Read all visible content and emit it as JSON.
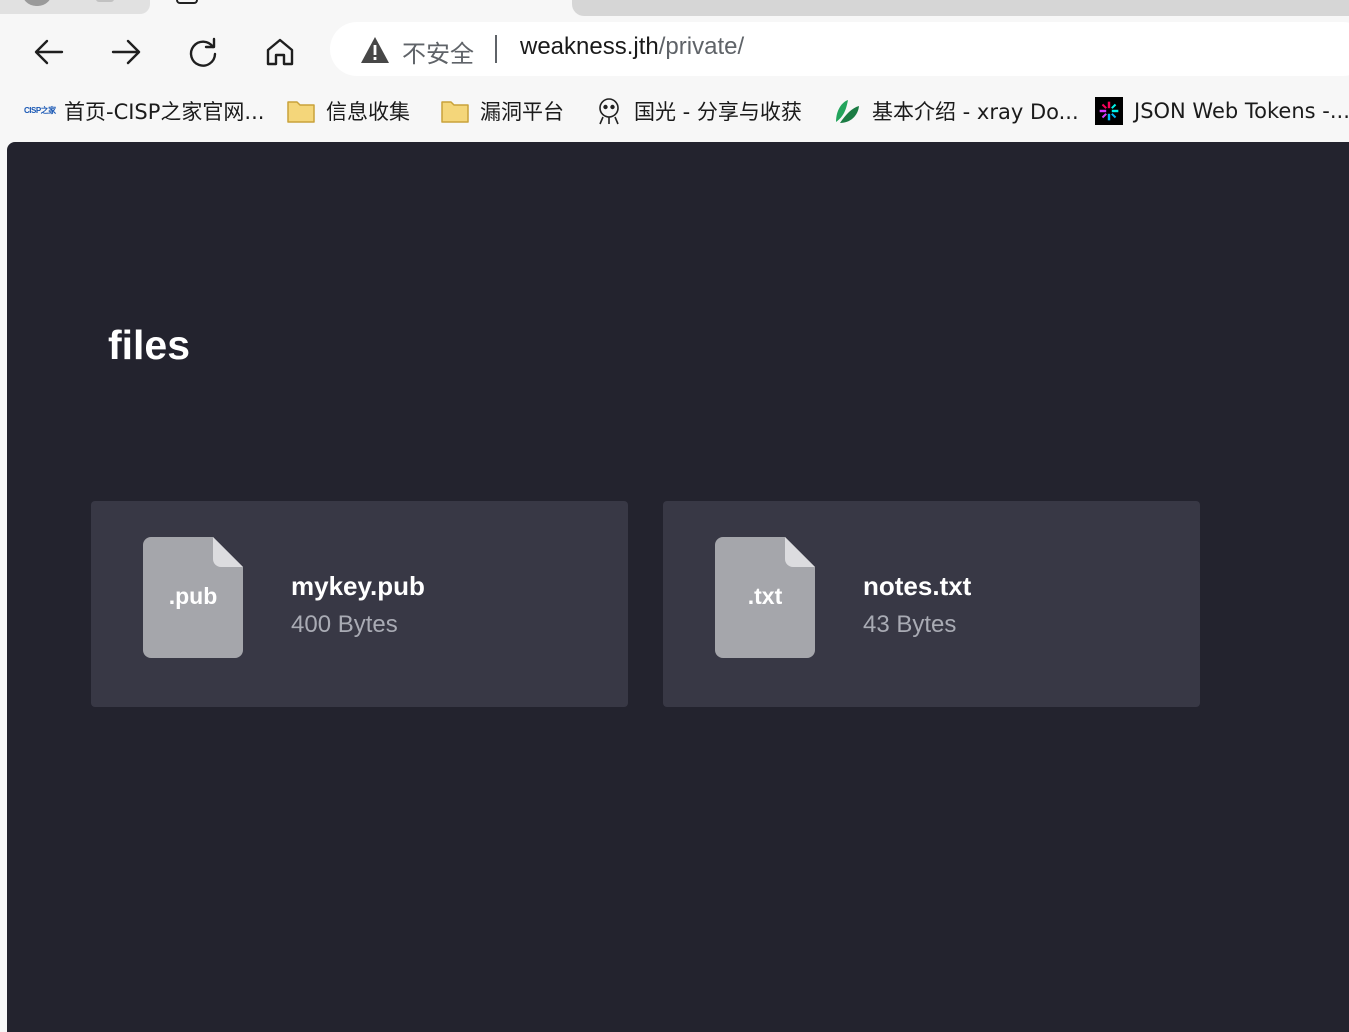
{
  "browser": {
    "address_bar": {
      "security_label": "不安全",
      "url_host": "weakness.jth",
      "url_path": "/private/"
    },
    "nav": {
      "back_icon": "arrow-left-icon",
      "forward_icon": "arrow-right-icon",
      "reload_icon": "reload-icon",
      "home_icon": "home-icon"
    },
    "bookmarks": [
      {
        "label": "首页-CISP之家官网...",
        "icon": "cisp-logo-icon",
        "icon_text": "CISP之家"
      },
      {
        "label": "信息收集",
        "icon": "folder-icon"
      },
      {
        "label": "漏洞平台",
        "icon": "folder-icon"
      },
      {
        "label": "国光 - 分享与收获",
        "icon": "sloth-avatar-icon"
      },
      {
        "label": "基本介绍 - xray Do...",
        "icon": "xray-leaf-icon"
      },
      {
        "label": "JSON Web Tokens -...",
        "icon": "jwt-logo-icon"
      }
    ],
    "colors": {
      "chrome_bg": "#f7f7f7",
      "folder": "#f4d67a"
    }
  },
  "page": {
    "title": "files",
    "background": "#23232e",
    "card_background": "#383845",
    "files": [
      {
        "ext": ".pub",
        "name": "mykey.pub",
        "size": "400 Bytes"
      },
      {
        "ext": ".txt",
        "name": "notes.txt",
        "size": "43 Bytes"
      }
    ]
  }
}
